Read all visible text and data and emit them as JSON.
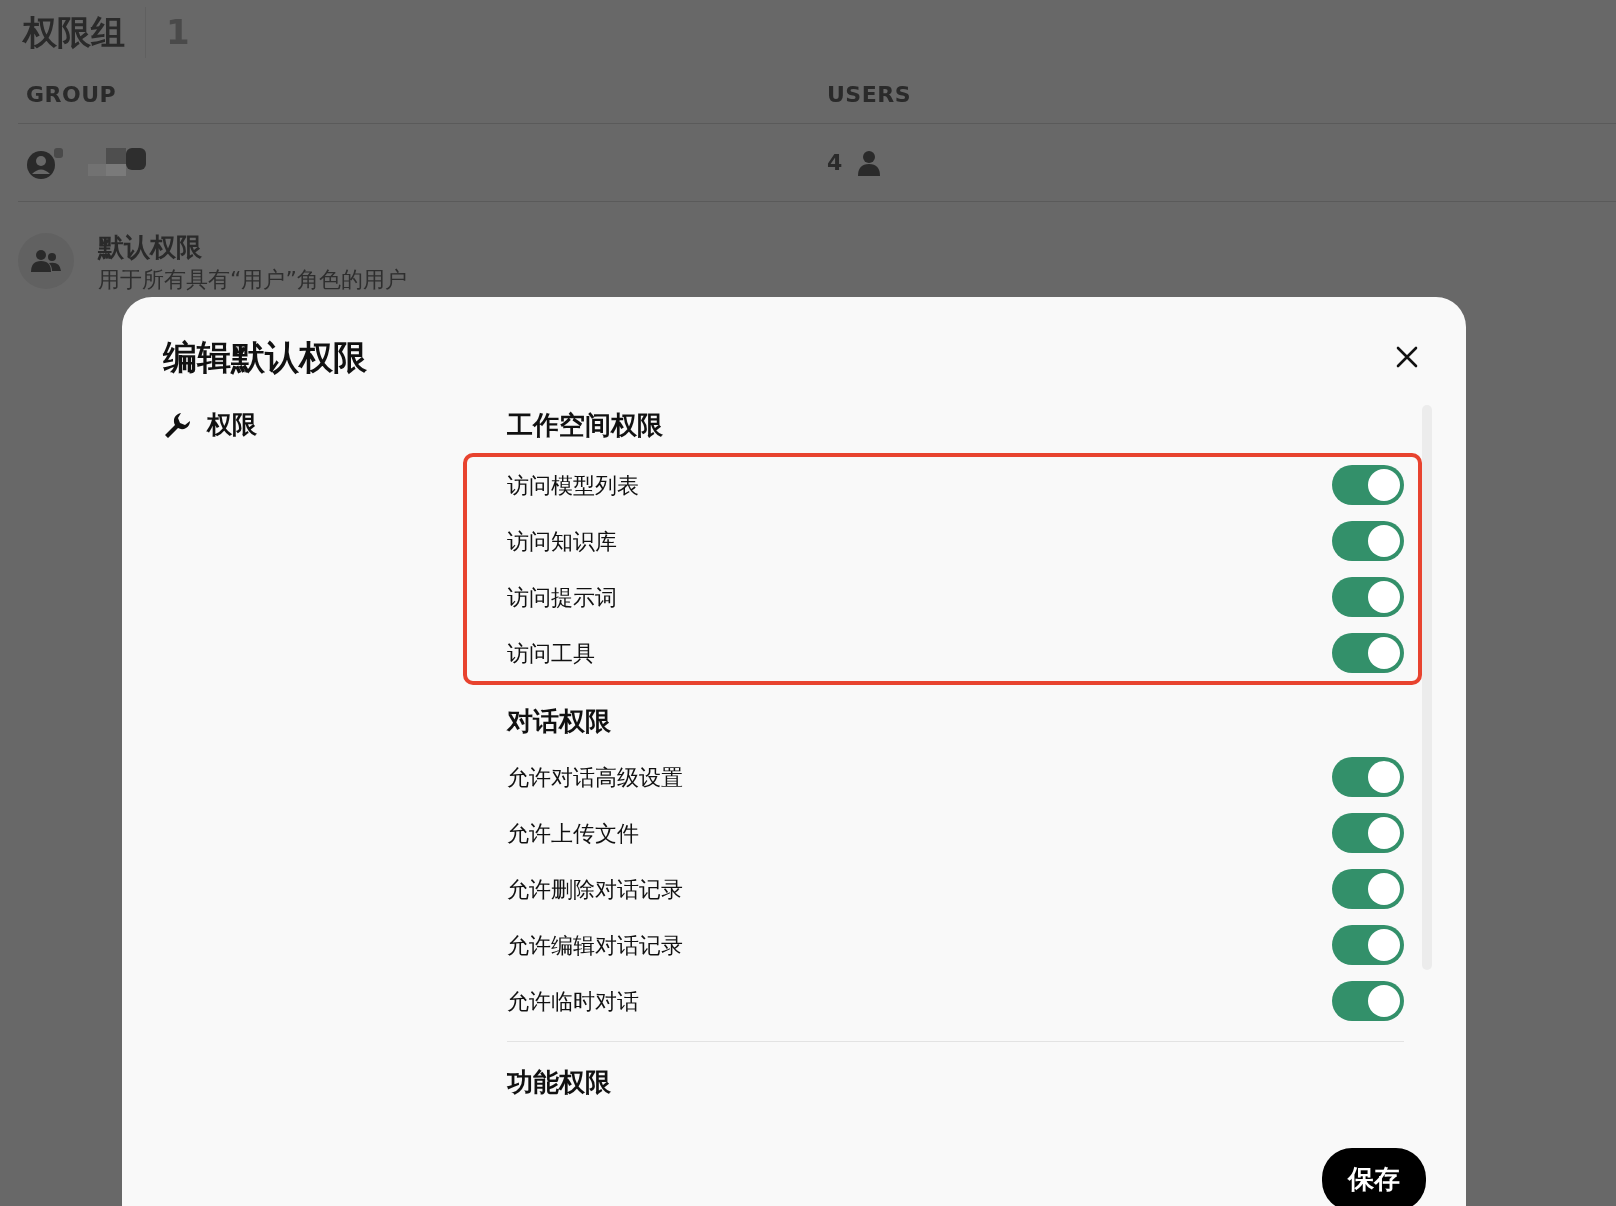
{
  "page": {
    "title": "权限组",
    "count": "1",
    "columns": [
      "GROUP",
      "USERS"
    ],
    "groups": [
      {
        "user_count": "4"
      }
    ],
    "default_permissions": {
      "title": "默认权限",
      "subtitle": "用于所有具有“用户”角色的用户"
    }
  },
  "modal": {
    "title": "编辑默认权限",
    "nav_items": [
      {
        "label": "权限"
      }
    ],
    "sections": [
      {
        "title": "工作空间权限",
        "highlighted": true,
        "permissions": [
          {
            "label": "访问模型列表",
            "on": true
          },
          {
            "label": "访问知识库",
            "on": true
          },
          {
            "label": "访问提示词",
            "on": true
          },
          {
            "label": "访问工具",
            "on": true
          }
        ]
      },
      {
        "title": "对话权限",
        "permissions": [
          {
            "label": "允许对话高级设置",
            "on": true
          },
          {
            "label": "允许上传文件",
            "on": true
          },
          {
            "label": "允许删除对话记录",
            "on": true
          },
          {
            "label": "允许编辑对话记录",
            "on": true
          },
          {
            "label": "允许临时对话",
            "on": true
          }
        ]
      },
      {
        "title": "功能权限",
        "divider_above": true
      }
    ],
    "save_button": "保存"
  }
}
